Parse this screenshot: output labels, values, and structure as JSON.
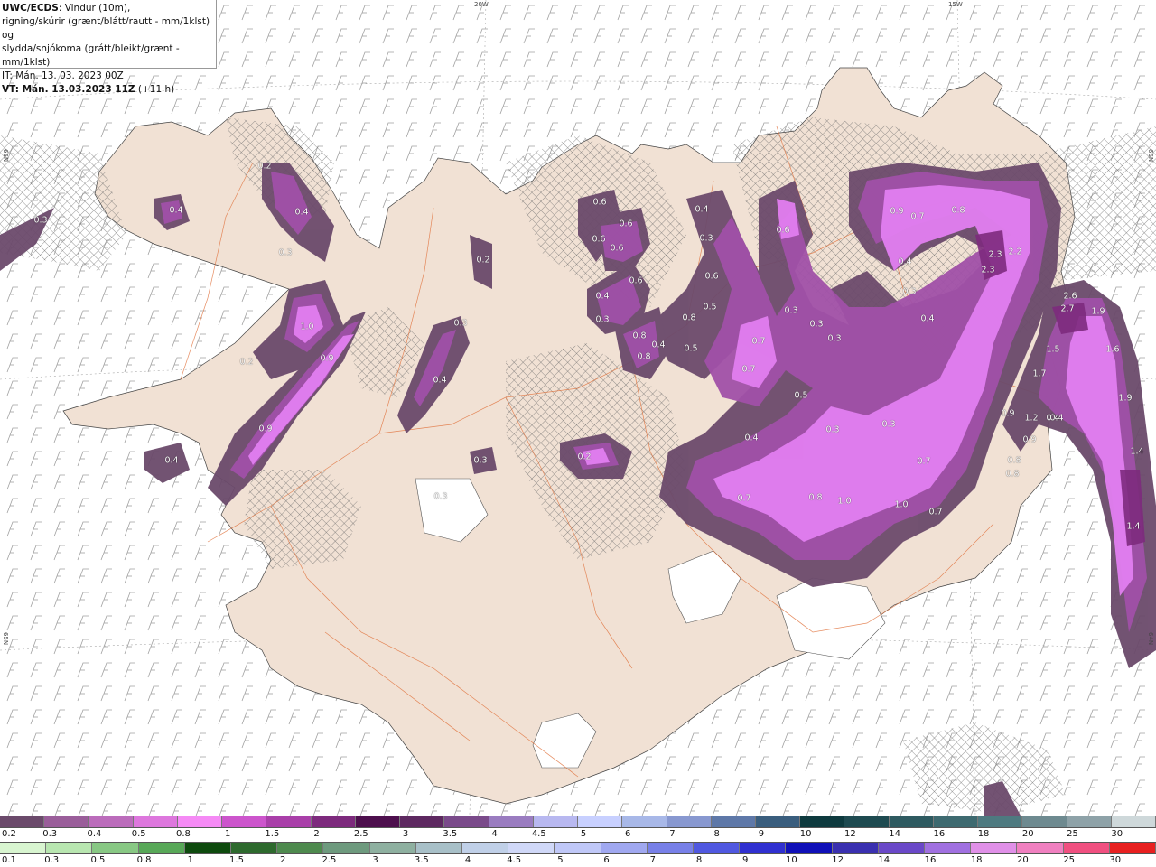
{
  "header": {
    "source_bold": "UWC/ECDS",
    "line1_rest": ": Vindur (10m),",
    "line2": "rigning/skúrir (grænt/blátt/rautt - mm/1klst) og",
    "line3": "slydda/snjókoma (grátt/bleikt/grænt - mm/1klst)",
    "line4": "IT: Mán. 13. 03. 2023 00Z",
    "valid_bold": "VT: Mán. 13.03.2023 11Z",
    "valid_rest": " (+11 h)"
  },
  "grid_labels": {
    "lon_20w": "20W",
    "lon_15w": "15W",
    "lat_66n_left": "66N",
    "lat_65n_left": "65N",
    "lat_66n_right": "66N",
    "lat_64n_right": "64N"
  },
  "value_labels": [
    "0.4",
    "0.4",
    "0.3",
    "0.2",
    "0.3",
    "1.0",
    "0.9",
    "0.2",
    "0.9",
    "0.4",
    "0.4",
    "0.3",
    "0.2",
    "0.3",
    "0.3",
    "0.2",
    "0.6",
    "0.6",
    "0.6",
    "0.6",
    "0.4",
    "0.3",
    "0.6",
    "0.4",
    "0.8",
    "0.4",
    "0.3",
    "0.6",
    "0.8",
    "0.5",
    "0.5",
    "0.7",
    "0.7",
    "0.6",
    "0.3",
    "0.3",
    "0.3",
    "0.5",
    "0.9",
    "0.7",
    "0.8",
    "0.4",
    "0.3",
    "0.4",
    "2.3",
    "2.2",
    "2.3",
    "2.6",
    "2.7",
    "1.9",
    "1.5",
    "1.6",
    "1.7",
    "1.9",
    "1.2",
    "0.4",
    "0.9",
    "0.9",
    "0.4",
    "0.3",
    "0.3",
    "0.7",
    "0.8",
    "0.8",
    "1.0",
    "1.0",
    "0.7",
    "0.7",
    "0.4",
    "0.8",
    "1.4",
    "1.4",
    "0.8"
  ],
  "legend": {
    "snow_scale": {
      "ticks": [
        "0.2",
        "0.3",
        "0.4",
        "0.5",
        "0.8",
        "1",
        "1.5",
        "2",
        "2.5",
        "3",
        "3.5",
        "4",
        "4.5",
        "5",
        "6",
        "7",
        "8",
        "9",
        "10",
        "12",
        "14",
        "16",
        "18",
        "20",
        "25",
        "30"
      ],
      "colors": [
        "#6b4a6b",
        "#9a5e9a",
        "#bb6cbb",
        "#dd77dd",
        "#f58af5",
        "#cc55cc",
        "#a93fa9",
        "#7d2a7d",
        "#4d0f4d",
        "#5d2860",
        "#7a4a8a",
        "#9a7cc0",
        "#b8b8f0",
        "#c8d0ff",
        "#a8b8e8",
        "#8898d0",
        "#5e78a8",
        "#3a5e7e",
        "#0e3a3e",
        "#1e4a50",
        "#2e5a60",
        "#3e6a70",
        "#4e7a80",
        "#6e8a90",
        "#8ea2a8",
        "#ced8da"
      ]
    },
    "rain_scale": {
      "ticks": [
        "0.1",
        "0.3",
        "0.5",
        "0.8",
        "1",
        "1.5",
        "2",
        "2.5",
        "3",
        "3.5",
        "4",
        "4.5",
        "5",
        "6",
        "7",
        "8",
        "9",
        "10",
        "12",
        "14",
        "16",
        "18",
        "20",
        "25",
        "30"
      ],
      "colors": [
        "#d8f5d0",
        "#b8e6b0",
        "#88c884",
        "#58a858",
        "#0e4a0e",
        "#2e6a2e",
        "#4e8a4e",
        "#6e9a7e",
        "#8eb0a0",
        "#a8c0c8",
        "#c0d0e8",
        "#d0d8f8",
        "#c0c8f8",
        "#a0a8f0",
        "#7880e8",
        "#5058e0",
        "#3030d0",
        "#1010b8",
        "#3a30b0",
        "#6a48c8",
        "#a070e0",
        "#e090e8",
        "#f080c0",
        "#f05080",
        "#e82020"
      ]
    }
  },
  "colors": {
    "land": "#f1e1d4",
    "sea": "#ffffff",
    "roads": "#e06020",
    "precip_dark": "#6b4a6b",
    "precip_mid": "#a050a8",
    "precip_bright": "#e070f0",
    "hatch": "#555555"
  }
}
